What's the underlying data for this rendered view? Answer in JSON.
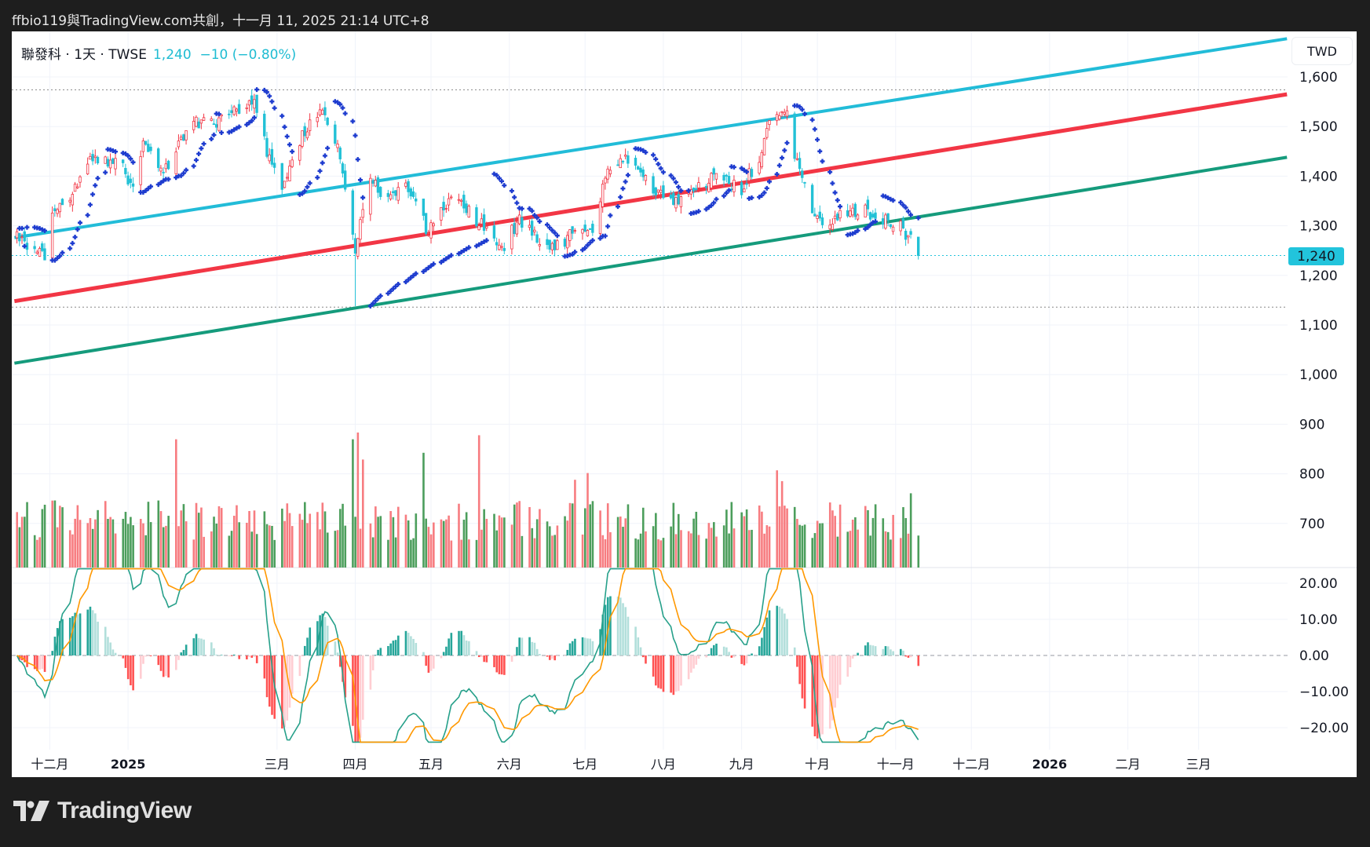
{
  "header": {
    "attribution": "ffbio119與TradingView.com共創，十一月 11, 2025 21:14 UTC+8"
  },
  "legend": {
    "symbol_info": "聯發科 · 1天 · TWSE",
    "quote": "1,240  −10 (−0.80%)"
  },
  "currency_button": "TWD",
  "last_price_tag": "1,240",
  "brand": {
    "name": "TradingView",
    "icon": "tradingview-logo-icon"
  },
  "colors": {
    "up": "#f23645",
    "down": "#22c1d6",
    "vol_up": "#f77c80",
    "vol_down": "#4c9e5c",
    "sar": "#1e3ccf",
    "macd": "#26a08a",
    "signal": "#ff9800",
    "channel_top": "#22bcd8",
    "channel_mid": "#f23645",
    "channel_bottom": "#159b7c"
  },
  "chart_data": {
    "type": "candlestick",
    "title": "聯發科 · 1天 · TWSE",
    "last_close": 1240,
    "change": -10,
    "change_pct": -0.8,
    "x_unit": "days since 2024-11-01",
    "price_axis": {
      "ylim": [
        680,
        1700
      ],
      "ticks": [
        {
          "v": 1600,
          "label": "1,600"
        },
        {
          "v": 1500,
          "label": "1,500"
        },
        {
          "v": 1400,
          "label": "1,400"
        },
        {
          "v": 1300,
          "label": "1,300"
        },
        {
          "v": 1200,
          "label": "1,200"
        },
        {
          "v": 1100,
          "label": "1,100"
        },
        {
          "v": 1000,
          "label": "1,000"
        },
        {
          "v": 900,
          "label": "900"
        },
        {
          "v": 800,
          "label": "800"
        },
        {
          "v": 700,
          "label": "700"
        }
      ]
    },
    "time_axis": [
      {
        "d": 30,
        "label": "十二月"
      },
      {
        "d": 61,
        "label": "2025",
        "bold": true
      },
      {
        "d": 120,
        "label": "三月"
      },
      {
        "d": 151,
        "label": "四月"
      },
      {
        "d": 181,
        "label": "五月"
      },
      {
        "d": 212,
        "label": "六月"
      },
      {
        "d": 242,
        "label": "七月"
      },
      {
        "d": 273,
        "label": "八月"
      },
      {
        "d": 304,
        "label": "九月"
      },
      {
        "d": 334,
        "label": "十月"
      },
      {
        "d": 365,
        "label": "十一月"
      },
      {
        "d": 395,
        "label": "十二月"
      },
      {
        "d": 426,
        "label": "2026",
        "bold": true
      },
      {
        "d": 457,
        "label": "二月"
      },
      {
        "d": 485,
        "label": "三月"
      }
    ],
    "close_path": [
      [
        16,
        1280
      ],
      [
        21,
        1253
      ],
      [
        28,
        1245
      ],
      [
        31,
        1323
      ],
      [
        41,
        1376
      ],
      [
        45,
        1430
      ],
      [
        59,
        1420
      ],
      [
        64,
        1360
      ],
      [
        67,
        1482
      ],
      [
        74,
        1403
      ],
      [
        80,
        1447
      ],
      [
        86,
        1517
      ],
      [
        93,
        1500
      ],
      [
        104,
        1535
      ],
      [
        111,
        1560
      ],
      [
        116,
        1447
      ],
      [
        123,
        1376
      ],
      [
        130,
        1490
      ],
      [
        138,
        1526
      ],
      [
        145,
        1447
      ],
      [
        151,
        1245
      ],
      [
        156,
        1403
      ],
      [
        163,
        1360
      ],
      [
        171,
        1376
      ],
      [
        180,
        1288
      ],
      [
        189,
        1360
      ],
      [
        197,
        1323
      ],
      [
        204,
        1288
      ],
      [
        209,
        1253
      ],
      [
        216,
        1315
      ],
      [
        228,
        1253
      ],
      [
        239,
        1288
      ],
      [
        246,
        1280
      ],
      [
        249,
        1394
      ],
      [
        259,
        1438
      ],
      [
        266,
        1394
      ],
      [
        277,
        1341
      ],
      [
        287,
        1376
      ],
      [
        294,
        1403
      ],
      [
        304,
        1376
      ],
      [
        311,
        1438
      ],
      [
        315,
        1500
      ],
      [
        322,
        1526
      ],
      [
        325,
        1447
      ],
      [
        332,
        1332
      ],
      [
        337,
        1288
      ],
      [
        343,
        1323
      ],
      [
        353,
        1332
      ],
      [
        360,
        1315
      ],
      [
        367,
        1297
      ],
      [
        370,
        1280
      ],
      [
        374,
        1240
      ]
    ],
    "extreme_lows": [
      {
        "d": 151,
        "low": 1138
      }
    ],
    "trend_lines": [
      {
        "name": "channel-top",
        "from": [
          16,
          1276
        ],
        "to": [
          520,
          1677
        ]
      },
      {
        "name": "channel-mid",
        "from": [
          16,
          1148
        ],
        "to": [
          520,
          1565
        ]
      },
      {
        "name": "channel-bottom",
        "from": [
          16,
          1023
        ],
        "to": [
          520,
          1438
        ]
      }
    ],
    "horizontal_levels": [
      1574,
      1136
    ],
    "volume_spikes": [
      {
        "d": 80,
        "rel": 0.95
      },
      {
        "d": 150,
        "rel": 0.95
      },
      {
        "d": 152,
        "rel": 1.0
      },
      {
        "d": 154,
        "rel": 0.8
      },
      {
        "d": 178,
        "rel": 0.85
      },
      {
        "d": 200,
        "rel": 0.98
      },
      {
        "d": 204,
        "rel": 0.8
      },
      {
        "d": 238,
        "rel": 0.65
      },
      {
        "d": 243,
        "rel": 0.7
      },
      {
        "d": 316,
        "rel": 0.6
      },
      {
        "d": 318,
        "rel": 0.72
      },
      {
        "d": 320,
        "rel": 0.64
      },
      {
        "d": 371,
        "rel": 0.55
      }
    ],
    "indicators": [
      "Volume",
      "Parabolic SAR (0.02, 0.2)",
      "MACD (12, 26, 9)"
    ],
    "macd_axis": {
      "ylim": [
        -25,
        25
      ],
      "ticks": [
        {
          "v": 20,
          "label": "20.00"
        },
        {
          "v": 10,
          "label": "10.00"
        },
        {
          "v": 0,
          "label": "0.00"
        },
        {
          "v": -10,
          "label": "−10.00"
        },
        {
          "v": -20,
          "label": "−20.00"
        }
      ]
    }
  }
}
